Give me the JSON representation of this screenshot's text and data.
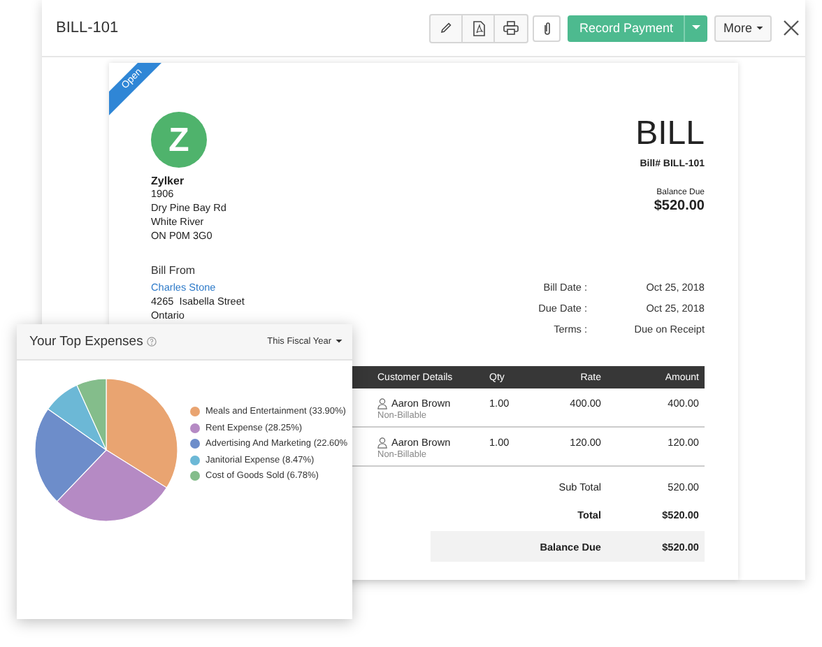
{
  "header": {
    "title": "BILL-101",
    "record_payment": "Record Payment",
    "more": "More"
  },
  "bill": {
    "status": "Open",
    "logo_letter": "Z",
    "company": "Zylker",
    "address": [
      "1906",
      "Dry Pine Bay Rd",
      "White River",
      "ON P0M 3G0"
    ],
    "bill_from_label": "Bill From",
    "vendor_name": "Charles Stone",
    "vendor_address": [
      "4265  Isabella Street",
      "Ontario"
    ],
    "title": "BILL",
    "number": "Bill# BILL-101",
    "balance_label": "Balance Due",
    "balance": "$520.00",
    "details": [
      {
        "label": "Bill Date :",
        "value": "Oct 25, 2018"
      },
      {
        "label": "Due Date :",
        "value": "Oct 25, 2018"
      },
      {
        "label": "Terms :",
        "value": "Due on Receipt"
      }
    ],
    "table": {
      "columns": [
        "Customer Details",
        "Qty",
        "Rate",
        "Amount"
      ],
      "rows": [
        {
          "customer": "Aaron Brown",
          "billing": "Non-Billable",
          "qty": "1.00",
          "rate": "400.00",
          "amount": "400.00"
        },
        {
          "customer": "Aaron Brown",
          "billing": "Non-Billable",
          "qty": "1.00",
          "rate": "120.00",
          "amount": "120.00"
        }
      ]
    },
    "totals": [
      {
        "kind": "plain",
        "label": "Sub Total",
        "value": "520.00"
      },
      {
        "kind": "bold",
        "label": "Total",
        "value": "$520.00"
      },
      {
        "kind": "highlight",
        "label": "Balance Due",
        "value": "$520.00"
      }
    ]
  },
  "expenses": {
    "title": "Your Top Expenses",
    "period": "This Fiscal Year",
    "chart_data": {
      "type": "pie",
      "categories": [
        "Meals and Entertainment (33.90%)",
        "Rent Expense (28.25%)",
        "Advertising And Marketing (22.60%",
        "Janitorial Expense (8.47%)",
        "Cost of Goods Sold (6.78%)"
      ],
      "values": [
        33.9,
        28.25,
        22.6,
        8.47,
        6.78
      ],
      "colors": [
        "#e9a471",
        "#b58ac4",
        "#6d8dca",
        "#6cb8d6",
        "#84bd8b"
      ]
    }
  }
}
